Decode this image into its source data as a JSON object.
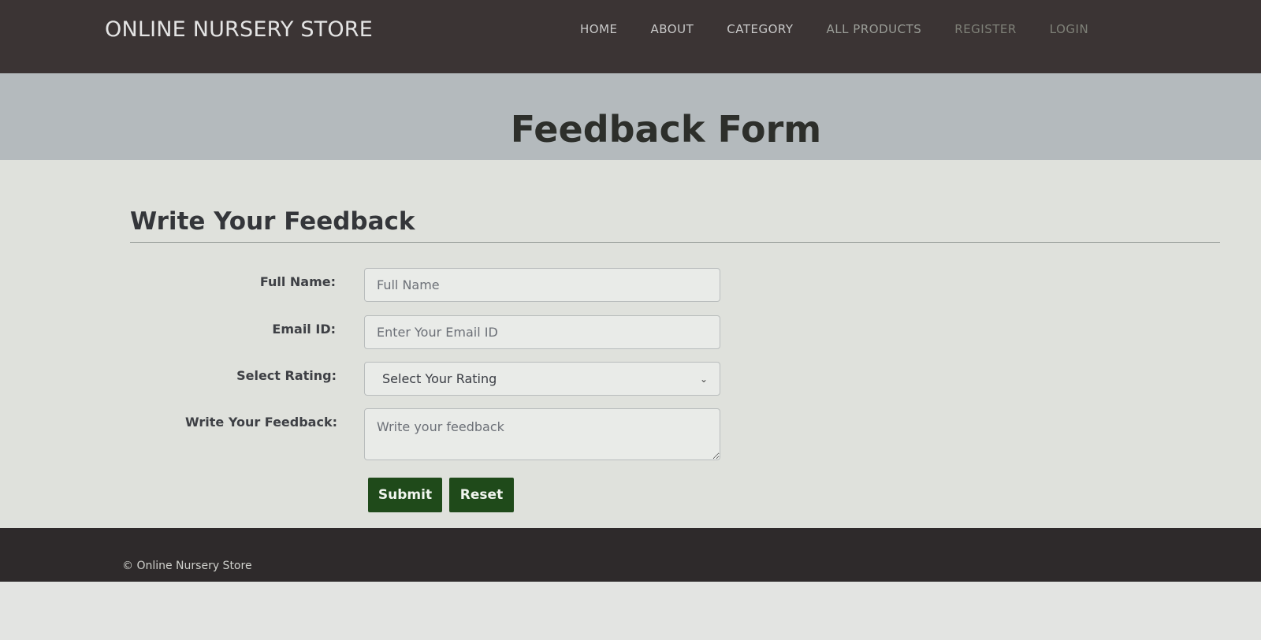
{
  "header": {
    "brand": "ONLINE NURSERY STORE",
    "nav": [
      "HOME",
      "ABOUT",
      "CATEGORY",
      "ALL PRODUCTS",
      "REGISTER",
      "LOGIN"
    ]
  },
  "banner": {
    "title": "Feedback Form"
  },
  "form": {
    "section_title": "Write Your Feedback",
    "full_name": {
      "label": "Full Name:",
      "placeholder": "Full Name"
    },
    "email": {
      "label": "Email ID:",
      "placeholder": "Enter Your Email ID"
    },
    "rating": {
      "label": "Select Rating:",
      "selected": "Select Your Rating"
    },
    "feedback": {
      "label": "Write Your Feedback:",
      "placeholder": "Write your feedback"
    },
    "submit_label": "Submit",
    "reset_label": "Reset"
  },
  "footer": {
    "copyright": "© Online Nursery Store"
  },
  "colors": {
    "navbar": "#3b3434",
    "button": "#1f4a1a",
    "banner": "#b4babd"
  }
}
